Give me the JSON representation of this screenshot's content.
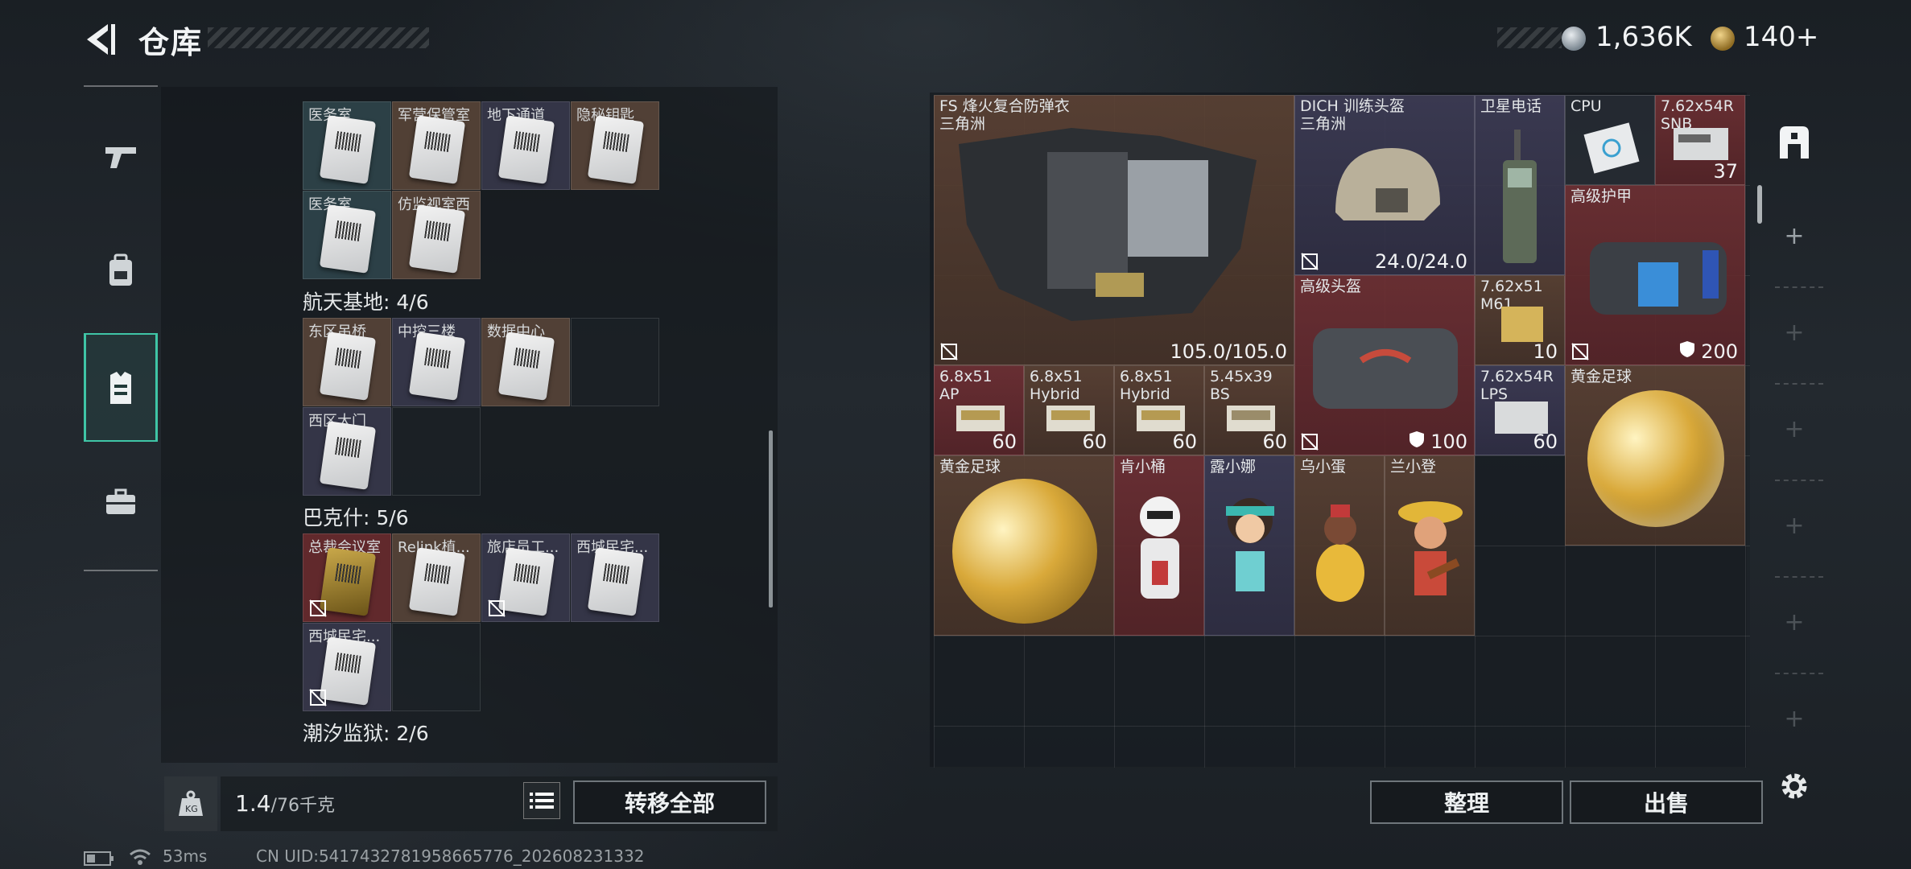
{
  "header": {
    "title": "仓库",
    "currency1": "1,636K",
    "currency2": "140+",
    "coin1_icon": "silver-coin-icon",
    "coin2_icon": "gold-coin-icon"
  },
  "nav": [
    {
      "icon": "pistol-icon"
    },
    {
      "icon": "backpack-icon"
    },
    {
      "icon": "vest-icon",
      "active": true
    },
    {
      "icon": "briefcase-icon"
    }
  ],
  "left": {
    "group1": [
      {
        "name": "医务室"
      },
      {
        "name": "军营保管室"
      },
      {
        "name": "地下通道"
      },
      {
        "name": "隐秘钥匙"
      },
      {
        "name": "医务室"
      },
      {
        "name": "仿监视室西"
      }
    ],
    "section_aerospace": "航天基地: 4/6",
    "group2": [
      {
        "name": "东区吊桥"
      },
      {
        "name": "中控三楼"
      },
      {
        "name": "数据中心"
      },
      {
        "name": "西区大门"
      }
    ],
    "section_brakkesh": "巴克什: 5/6",
    "group3": [
      {
        "name": "总裁会议室"
      },
      {
        "name": "Relink植..."
      },
      {
        "name": "旅店员工..."
      },
      {
        "name": "西城民宅..."
      },
      {
        "name": "西城民宅..."
      }
    ],
    "section_tide": "潮汐监狱: 2/6"
  },
  "bottom_left": {
    "weight_value": "1.4",
    "weight_unit": "/76千克",
    "transfer_label": "转移全部"
  },
  "right": {
    "armor": {
      "name": "FS 烽火复合防弹衣\n三角洲",
      "value": "105.0/105.0"
    },
    "helmet_train": {
      "name": "DICH 训练头盔\n三角洲",
      "value": "24.0/24.0"
    },
    "satphone": {
      "name": "卫星电话"
    },
    "cpu": {
      "name": "CPU"
    },
    "ammo_snb": {
      "name": "7.62x54R\nSNB",
      "value": "37"
    },
    "adv_armor": {
      "name": "高级护甲",
      "value": "200"
    },
    "adv_helmet": {
      "name": "高级头盔",
      "value": "100"
    },
    "ammo_m61": {
      "name": "7.62x51\nM61",
      "value": "10"
    },
    "ammo_ap": {
      "name": "6.8x51\nAP",
      "value": "60"
    },
    "ammo_hybrid1": {
      "name": "6.8x51\nHybrid",
      "value": "60"
    },
    "ammo_hybrid2": {
      "name": "6.8x51\nHybrid",
      "value": "60"
    },
    "ammo_bs": {
      "name": "5.45x39\nBS",
      "value": "60"
    },
    "ammo_lps": {
      "name": "7.62x54R\nLPS",
      "value": "60"
    },
    "gold_ball1": {
      "name": "黄金足球"
    },
    "gold_ball2": {
      "name": "黄金足球"
    },
    "fig1": {
      "name": "肯小桶"
    },
    "fig2": {
      "name": "露小娜"
    },
    "fig3": {
      "name": "乌小蛋"
    },
    "fig4": {
      "name": "兰小登"
    }
  },
  "bottom_right": {
    "sort_label": "整理",
    "sell_label": "出售"
  },
  "status": {
    "ping": "53ms",
    "uid": "CN UID:5417432781958665776_202608231332"
  }
}
